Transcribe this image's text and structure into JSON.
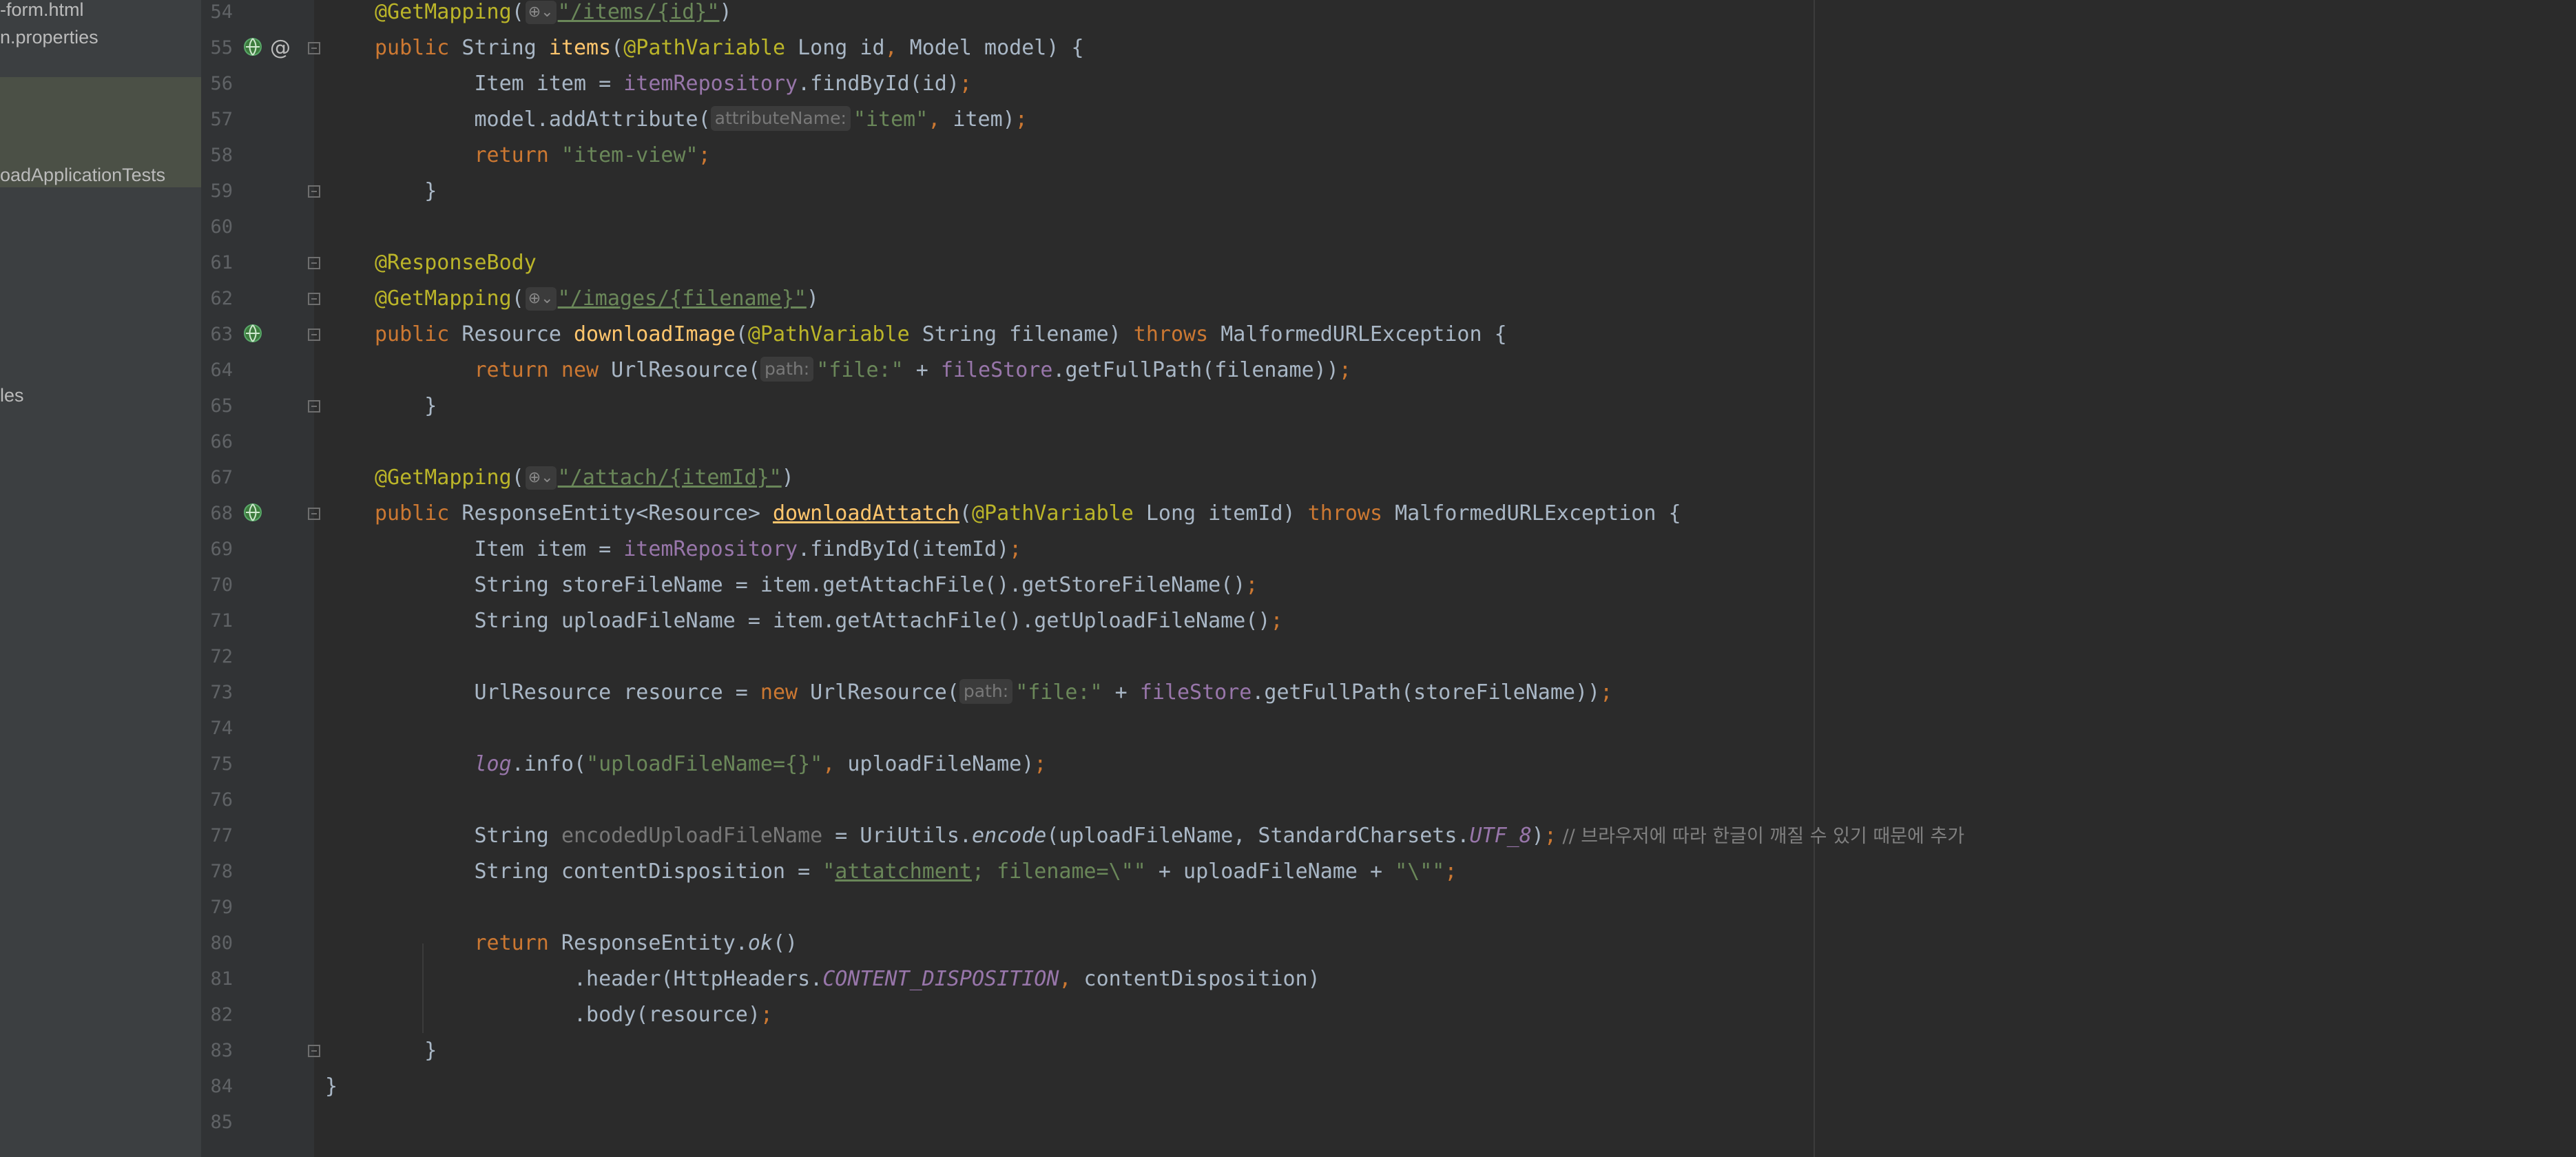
{
  "sidebar": {
    "items": [
      {
        "label": "-form.html"
      },
      {
        "label": "n.properties"
      },
      {
        "label": "oadApplicationTests"
      },
      {
        "label": "les"
      }
    ]
  },
  "gutter": {
    "lines": [
      "54",
      "55",
      "56",
      "57",
      "58",
      "59",
      "60",
      "61",
      "62",
      "63",
      "64",
      "65",
      "66",
      "67",
      "68",
      "69",
      "70",
      "71",
      "72",
      "73",
      "74",
      "75",
      "76",
      "77",
      "78",
      "79",
      "80",
      "81",
      "82",
      "83",
      "84",
      "85"
    ],
    "at_symbol": "@"
  },
  "code": {
    "l54": {
      "a": "@GetMapping",
      "b": "(",
      "g": "⊕⌄",
      "s": "\"/items/{id}\"",
      "c": ")"
    },
    "l55": {
      "a": "public",
      "b": " String ",
      "m": "items",
      "c": "(",
      "an": "@PathVariable",
      "d": " Long id",
      "e": ",",
      "f": " Model model) {"
    },
    "l56": {
      "a": "        Item item = ",
      "f": "itemRepository",
      "b": ".findById(id)",
      "c": ";"
    },
    "l57": {
      "a": "        model.addAttribute(",
      "h": "attributeName:",
      "s": "\"item\"",
      "c": ",",
      "b": " item)",
      "d": ";"
    },
    "l58": {
      "a": "        ",
      "k": "return",
      "s": " \"item-view\"",
      "c": ";"
    },
    "l59": {
      "a": "    }"
    },
    "l61": {
      "a": "@ResponseBody"
    },
    "l62": {
      "a": "@GetMapping",
      "b": "(",
      "g": "⊕⌄",
      "s": "\"/images/{filename}\"",
      "c": ")"
    },
    "l63": {
      "k": "public",
      "b": " Resource ",
      "m": "downloadImage",
      "c": "(",
      "an": "@PathVariable",
      "d": " String filename) ",
      "k2": "throws",
      "e": " MalformedURLException {"
    },
    "l64": {
      "a": "        ",
      "k": "return new",
      "b": " UrlResource(",
      "h": "path:",
      "s": "\"file:\"",
      "d": " + ",
      "f": "fileStore",
      "e": ".getFullPath(filename))",
      "c": ";"
    },
    "l65": {
      "a": "    }"
    },
    "l67": {
      "a": "@GetMapping",
      "b": "(",
      "g": "⊕⌄",
      "s": "\"/attach/{itemId}\"",
      "c": ")"
    },
    "l68": {
      "k": "public",
      "b": " ResponseEntity<Resource> ",
      "m": "downloadAttatch",
      "c": "(",
      "an": "@PathVariable",
      "d": " Long itemId) ",
      "k2": "throws",
      "e": " MalformedURLException {"
    },
    "l69": {
      "a": "        Item item = ",
      "f": "itemRepository",
      "b": ".findById(itemId)",
      "c": ";"
    },
    "l70": {
      "a": "        String storeFileName = item.getAttachFile().getStoreFileName()",
      "c": ";"
    },
    "l71": {
      "a": "        String uploadFileName = item.getAttachFile().getUploadFileName()",
      "c": ";"
    },
    "l73": {
      "a": "        UrlResource resource = ",
      "k": "new",
      "b": " UrlResource(",
      "h": "path:",
      "s": "\"file:\"",
      "d": " + ",
      "f": "fileStore",
      "e": ".getFullPath(storeFileName))",
      "c": ";"
    },
    "l75": {
      "a": "        ",
      "l": "log",
      "b": ".info(",
      "s": "\"uploadFileName={}\"",
      "c": ",",
      "d": " uploadFileName)",
      "e": ";"
    },
    "l77": {
      "a": "        String ",
      "u": "encodedUploadFileName",
      "b": " = UriUtils.",
      "it": "encode",
      "d": "(uploadFileName, StandardCharsets.",
      "sf": "UTF_8",
      "e": ")",
      "c": ";",
      "cm": " // 브라우저에 따라 한글이 깨질 수 있기 때문에 추가"
    },
    "l78": {
      "a": "        String contentDisposition = ",
      "s1": "\"",
      "s2": "attatchment",
      "s3": "; filename=\\\"\"",
      "b": " + uploadFileName + ",
      "s4": "\"\\\"\"",
      "c": ";"
    },
    "l80": {
      "a": "        ",
      "k": "return",
      "b": " ResponseEntity.",
      "it": "ok",
      "d": "()"
    },
    "l81": {
      "a": "                .header(HttpHeaders.",
      "sf": "CONTENT_DISPOSITION",
      "c": ",",
      "b": " contentDisposition)"
    },
    "l82": {
      "a": "                .body(resource)",
      "c": ";"
    },
    "l83": {
      "a": "    }"
    },
    "l84": {
      "a": "}"
    }
  },
  "colors": {
    "bg": "#2b2b2b",
    "keyword": "#cc7832",
    "annotation": "#bbb529",
    "string": "#6a8759",
    "field": "#9876aa",
    "method": "#ffc66d",
    "text": "#a9b7c6"
  }
}
